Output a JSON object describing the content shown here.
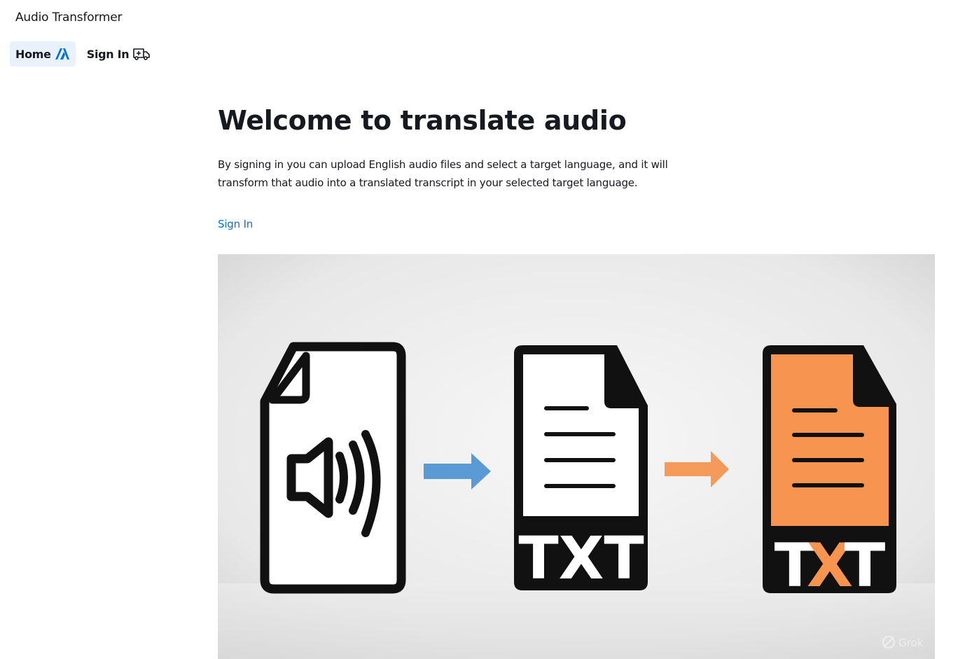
{
  "header": {
    "brand": "Audio Transformer"
  },
  "nav": [
    {
      "label": "Home",
      "icon": "aws-amplify-icon",
      "active": true
    },
    {
      "label": "Sign In",
      "icon": "ambulance-icon",
      "active": false
    }
  ],
  "main": {
    "title": "Welcome to translate audio",
    "description": "By signing in you can upload English audio files and select a target language, and it will transform that audio into a translated transcript in your selected target language.",
    "signin_link": "Sign In"
  },
  "hero": {
    "card2_label": "TXT",
    "card3_label_left": "T",
    "card3_label_mid": "X",
    "card3_label_right": "T",
    "watermark": "Grok",
    "arrow1_color": "#5b9bd5",
    "arrow2_color": "#f49a5a",
    "card3_fill": "#f7944f"
  },
  "colors": {
    "link": "#0972d3",
    "active_bg": "#e9f1fc",
    "text": "#16191f"
  }
}
